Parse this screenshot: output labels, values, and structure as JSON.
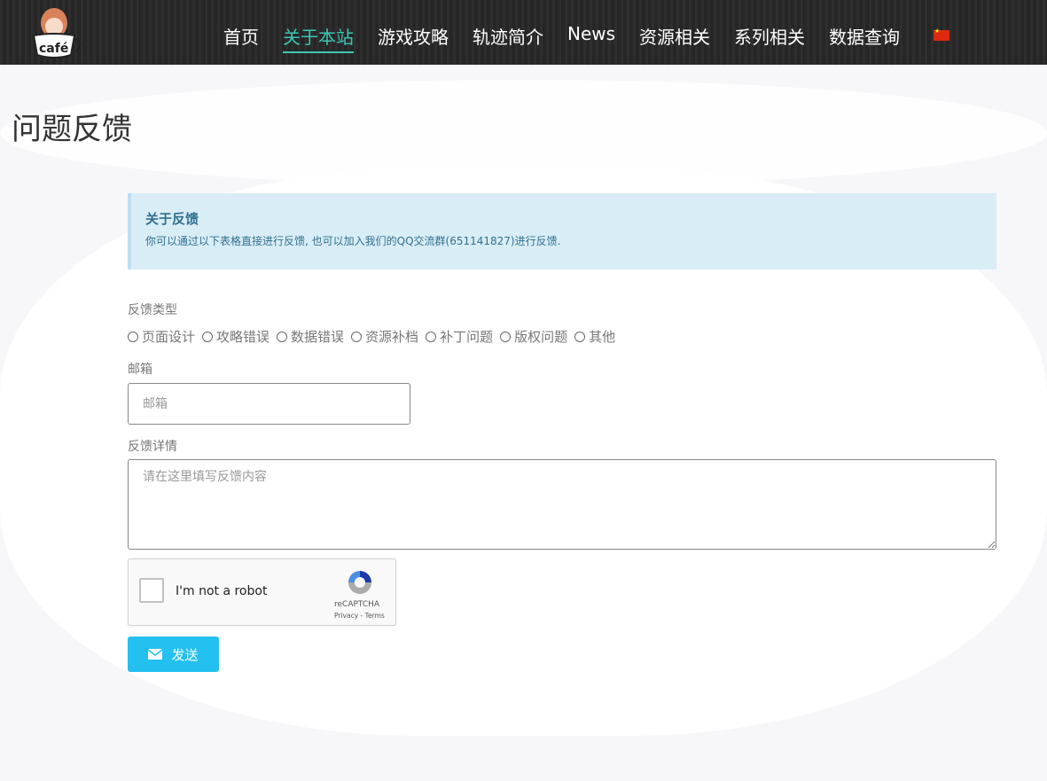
{
  "nav": {
    "logo_text": "café",
    "items": [
      {
        "label": "首页"
      },
      {
        "label": "关于本站",
        "active": true
      },
      {
        "label": "游戏攻略"
      },
      {
        "label": "轨迹简介"
      },
      {
        "label": "News"
      },
      {
        "label": "资源相关"
      },
      {
        "label": "系列相关"
      },
      {
        "label": "数据查询"
      }
    ],
    "language": "zh-CN flag"
  },
  "page_title": "问题反馈",
  "alert": {
    "title": "关于反馈",
    "text": "你可以通过以下表格直接进行反馈, 也可以加入我们的QQ交流群(651141827)进行反馈."
  },
  "form": {
    "type_label": "反馈类型",
    "types": [
      "页面设计",
      "攻略错误",
      "数据错误",
      "资源补档",
      "补丁问题",
      "版权问题",
      "其他"
    ],
    "email_label": "邮箱",
    "email_placeholder": "邮箱",
    "detail_label": "反馈详情",
    "detail_placeholder": "请在这里填写反馈内容",
    "captcha": {
      "label": "I'm not a robot",
      "brand": "reCAPTCHA",
      "privacy": "Privacy",
      "terms": "Terms"
    },
    "submit_label": "发送"
  },
  "colors": {
    "accent": "#3cc7b4",
    "button": "#23c0f0",
    "alert_bg": "#d9edf7"
  }
}
